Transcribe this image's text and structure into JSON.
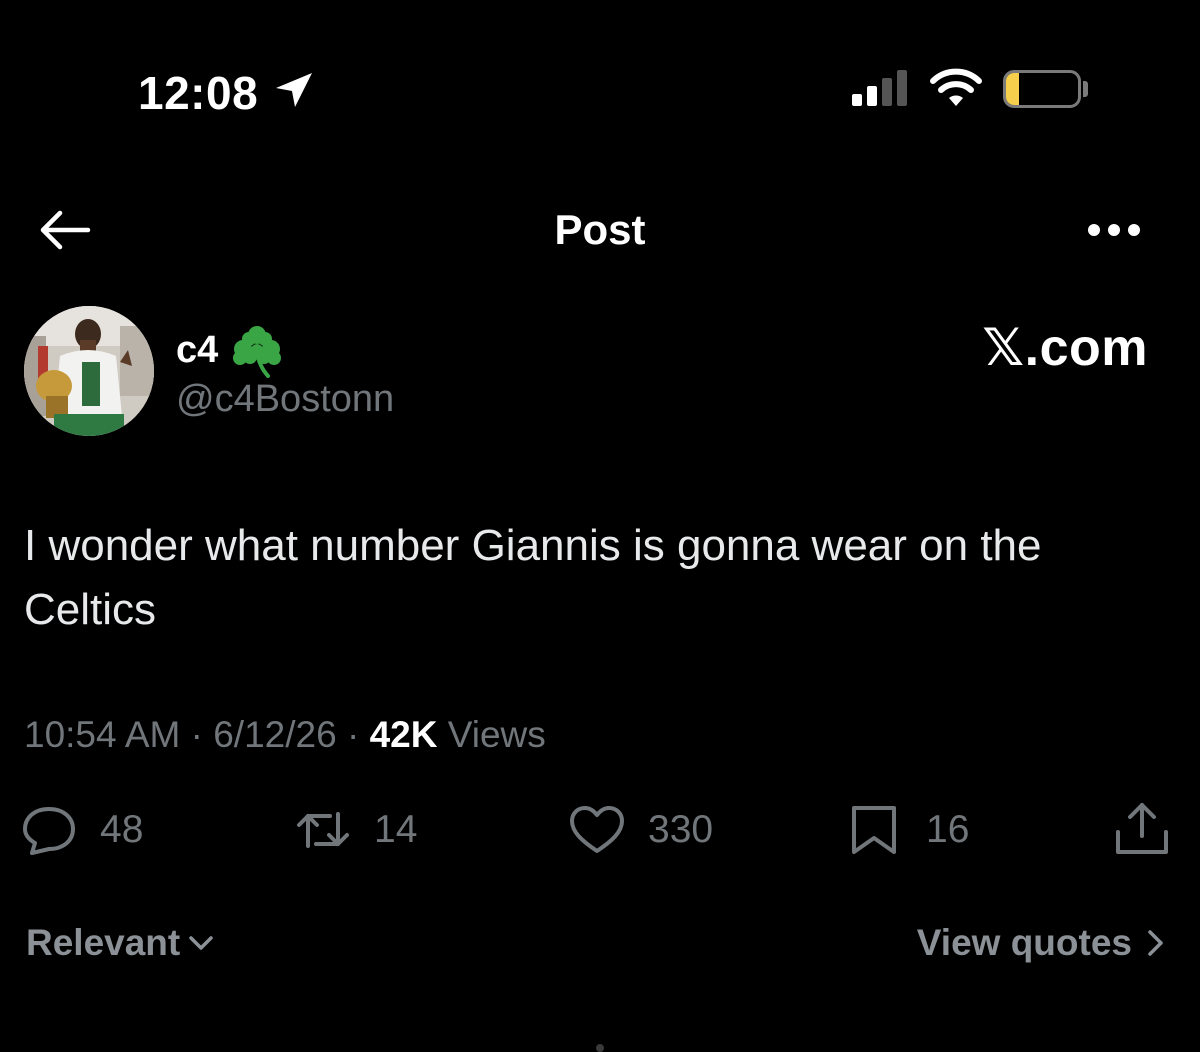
{
  "status_bar": {
    "time": "12:08",
    "battery": "18",
    "battery_level": 0.18,
    "icons": [
      "location-arrow-icon",
      "cellular-signal-icon",
      "wifi-icon",
      "battery-icon"
    ]
  },
  "header": {
    "title": "Post",
    "back_icon": "arrow-left-icon",
    "more_icon": "more-horizontal-icon"
  },
  "author": {
    "display_name": "c4",
    "emoji": "shamrock",
    "handle": "@c4Bostonn"
  },
  "watermark": "𝕏.com",
  "post": {
    "text": "I wonder what number Giannis is gonna wear on the Celtics"
  },
  "meta": {
    "time": "10:54 AM",
    "separator": "·",
    "date": "6/12/26",
    "views_count": "42K",
    "views_label": "Views"
  },
  "actions": {
    "replies": "48",
    "reposts": "14",
    "likes": "330",
    "bookmarks": "16"
  },
  "footer": {
    "sort_label": "Relevant",
    "view_quotes_label": "View quotes"
  },
  "colors": {
    "background": "#000000",
    "primary_text": "#e7e9ea",
    "secondary_text": "#71767b",
    "battery_fill": "#f6d04d",
    "shamrock": "#3aa545"
  }
}
